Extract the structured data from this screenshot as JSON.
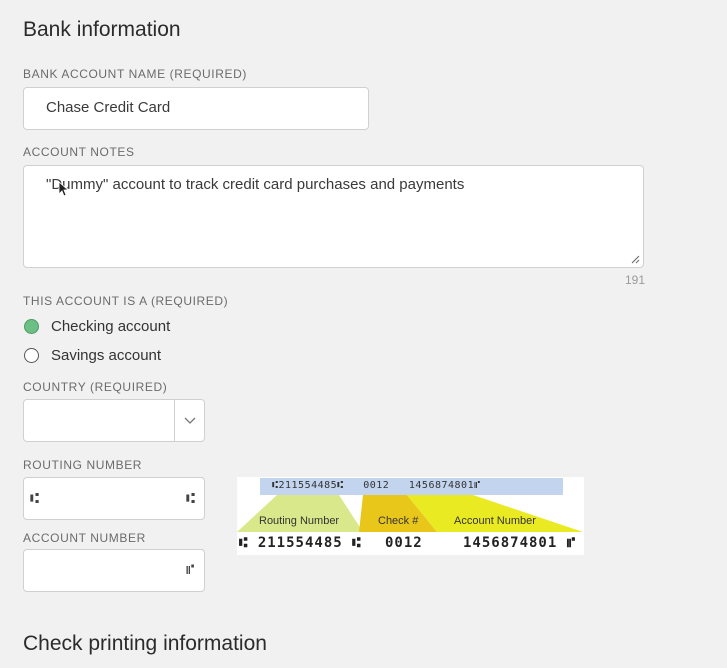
{
  "bank_info": {
    "title": "Bank information",
    "account_name_label": "BANK ACCOUNT NAME (REQUIRED)",
    "account_name_value": "Chase Credit Card",
    "notes_label": "ACCOUNT NOTES",
    "notes_value": "\"Dummy\" account to track credit card purchases and payments",
    "notes_counter": "191",
    "account_type_label": "THIS ACCOUNT IS A (REQUIRED)",
    "account_type_options": [
      {
        "label": "Checking account",
        "selected": true
      },
      {
        "label": "Savings account",
        "selected": false
      }
    ],
    "country_label": "COUNTRY (REQUIRED)",
    "country_value": "",
    "routing_label": "ROUTING NUMBER",
    "routing_value": "",
    "routing_prefix_symbol": "⑆",
    "routing_suffix_symbol": "⑆",
    "account_number_label": "ACCOUNT NUMBER",
    "account_number_value": "",
    "account_number_suffix_symbol": "⑈"
  },
  "check_image": {
    "top_line": "⑆211554485⑆   0012   1456874801⑈",
    "routing_label": "Routing Number",
    "check_label": "Check #",
    "account_label": "Account Number",
    "micr_routing": "⑆ 211554485 ⑆",
    "micr_check": "0012",
    "micr_account": "1456874801 ⑈",
    "colors": {
      "top_band": "#c2d4ee",
      "routing_fill": "#d9e88a",
      "check_fill": "#e8c61a",
      "account_fill": "#eaea22"
    }
  },
  "check_printing": {
    "title": "Check printing information"
  }
}
